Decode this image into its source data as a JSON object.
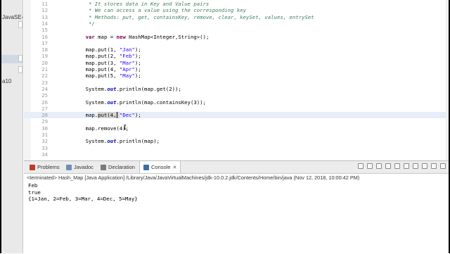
{
  "sidebar": {
    "label_1": "JavaSE-",
    "label_2": "a10"
  },
  "editor": {
    "lines": [
      {
        "num": "11",
        "parts": [
          {
            "t": "     * It stores data in Key and Value pairs",
            "c": "cm"
          }
        ]
      },
      {
        "num": "12",
        "parts": [
          {
            "t": "     * We can access a value using the corresponding key",
            "c": "cm"
          }
        ]
      },
      {
        "num": "13",
        "parts": [
          {
            "t": "     * Methods: put, get, containsKey, remove, clear, keySet, values, entrySet",
            "c": "cm"
          }
        ]
      },
      {
        "num": "14",
        "parts": [
          {
            "t": "     */",
            "c": "cm"
          }
        ]
      },
      {
        "num": "15",
        "parts": []
      },
      {
        "num": "16",
        "parts": [
          {
            "t": "    "
          },
          {
            "t": "var",
            "c": "kw"
          },
          {
            "t": " map = "
          },
          {
            "t": "new",
            "c": "kw"
          },
          {
            "t": " HashMap<Integer,String>();"
          }
        ]
      },
      {
        "num": "17",
        "parts": []
      },
      {
        "num": "18",
        "parts": [
          {
            "t": "    map.put(1, "
          },
          {
            "t": "\"Jan\"",
            "c": "st"
          },
          {
            "t": ");"
          }
        ]
      },
      {
        "num": "19",
        "parts": [
          {
            "t": "    map.put(2, "
          },
          {
            "t": "\"Feb\"",
            "c": "st"
          },
          {
            "t": ");"
          }
        ]
      },
      {
        "num": "20",
        "parts": [
          {
            "t": "    map.put(3, "
          },
          {
            "t": "\"Mar\"",
            "c": "st"
          },
          {
            "t": ");"
          }
        ]
      },
      {
        "num": "21",
        "parts": [
          {
            "t": "    map.put(4, "
          },
          {
            "t": "\"Apr\"",
            "c": "st"
          },
          {
            "t": ");"
          }
        ]
      },
      {
        "num": "22",
        "parts": [
          {
            "t": "    map.put(5, "
          },
          {
            "t": "\"May\"",
            "c": "st"
          },
          {
            "t": ");"
          }
        ]
      },
      {
        "num": "23",
        "parts": []
      },
      {
        "num": "24",
        "parts": [
          {
            "t": "    System."
          },
          {
            "t": "out",
            "c": "fld"
          },
          {
            "t": ".println(map.get(2));"
          }
        ]
      },
      {
        "num": "25",
        "parts": []
      },
      {
        "num": "26",
        "parts": [
          {
            "t": "    System."
          },
          {
            "t": "out",
            "c": "fld"
          },
          {
            "t": ".println(map.containsKey(3));"
          }
        ]
      },
      {
        "num": "27",
        "parts": []
      },
      {
        "num": "28",
        "parts": [
          {
            "t": "    map."
          },
          {
            "t": "put(4, ",
            "c": "mark"
          },
          {
            "t": "\"Dec\"",
            "c": "st"
          },
          {
            "t": ");"
          }
        ],
        "highlight": true
      },
      {
        "num": "29",
        "parts": []
      },
      {
        "num": "30",
        "parts": [
          {
            "t": "    map.remove(4);"
          }
        ]
      },
      {
        "num": "31",
        "parts": []
      },
      {
        "num": "32",
        "parts": [
          {
            "t": "    System."
          },
          {
            "t": "out",
            "c": "fld"
          },
          {
            "t": ".println(map);"
          }
        ]
      },
      {
        "num": "33",
        "parts": []
      },
      {
        "num": "34",
        "parts": []
      }
    ]
  },
  "panel": {
    "tabs": [
      {
        "label": "Problems",
        "icon": "problems-icon",
        "color": "#c0392b"
      },
      {
        "label": "Javadoc",
        "icon": "javadoc-icon",
        "color": "#6d8fb5"
      },
      {
        "label": "Declaration",
        "icon": "declaration-icon",
        "color": "#7a7a7a"
      },
      {
        "label": "Console",
        "icon": "console-icon",
        "color": "#3b6ea5",
        "active": true
      }
    ],
    "status": "<terminated> Hash_Map [Java Application] /Library/Java/JavaVirtualMachines/jdk-10.0.2.jdk/Contents/Home/bin/java (Nov 12, 2018, 10:00:42 PM)",
    "output": [
      "Feb",
      "true",
      "{1=Jan, 2=Feb, 3=Mar, 4=Dec, 5=May}"
    ]
  },
  "colors": {
    "comment": "#3f7f5f",
    "keyword": "#7f0055",
    "string": "#2a00ff",
    "field": "#0000c0",
    "line_highlight": "#e8eef8"
  }
}
